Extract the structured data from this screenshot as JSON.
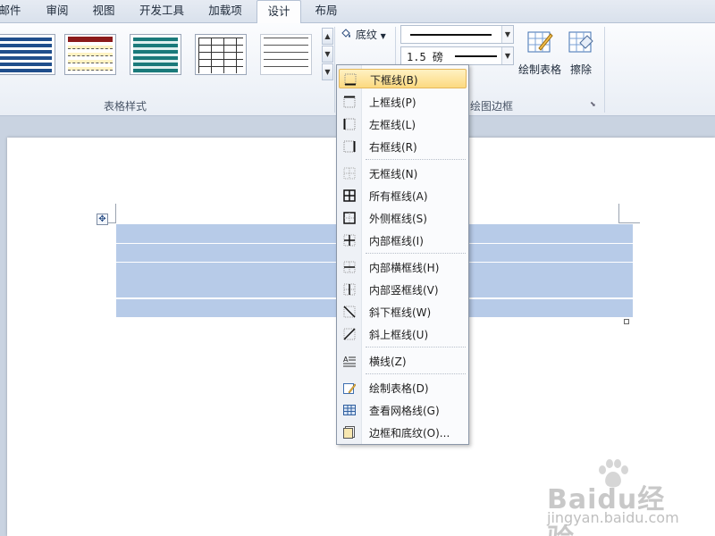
{
  "tabs": [
    {
      "label": "邮件",
      "active": false
    },
    {
      "label": "审阅",
      "active": false
    },
    {
      "label": "视图",
      "active": false
    },
    {
      "label": "开发工具",
      "active": false
    },
    {
      "label": "加载项",
      "active": false
    },
    {
      "label": "设计",
      "active": true
    },
    {
      "label": "布局",
      "active": false
    }
  ],
  "ribbon": {
    "table_styles_label": "表格样式",
    "shading_label": "底纹",
    "borders_label": "边框",
    "line_weight": "1.5 磅",
    "draw_table_label": "绘制表格",
    "eraser_label": "擦除",
    "draw_borders_label": "绘图边框",
    "swatch_colors": [
      "#1f4e8c",
      "#8b1a1a",
      "#1a7a7a",
      "#333333",
      "#333333"
    ]
  },
  "menu": {
    "items": [
      {
        "label": "下框线(B)",
        "icon": "bottom-border-icon",
        "highlighted": true
      },
      {
        "label": "上框线(P)",
        "icon": "top-border-icon"
      },
      {
        "label": "左框线(L)",
        "icon": "left-border-icon"
      },
      {
        "label": "右框线(R)",
        "icon": "right-border-icon"
      },
      {
        "label": "无框线(N)",
        "icon": "no-border-icon"
      },
      {
        "label": "所有框线(A)",
        "icon": "all-borders-icon"
      },
      {
        "label": "外侧框线(S)",
        "icon": "outside-borders-icon"
      },
      {
        "label": "内部框线(I)",
        "icon": "inside-borders-icon"
      },
      {
        "label": "内部横框线(H)",
        "icon": "inside-horizontal-border-icon"
      },
      {
        "label": "内部竖框线(V)",
        "icon": "inside-vertical-border-icon"
      },
      {
        "label": "斜下框线(W)",
        "icon": "diagonal-down-border-icon"
      },
      {
        "label": "斜上框线(U)",
        "icon": "diagonal-up-border-icon"
      },
      {
        "label": "横线(Z)",
        "icon": "horizontal-line-icon"
      },
      {
        "label": "绘制表格(D)",
        "icon": "draw-table-icon"
      },
      {
        "label": "查看网格线(G)",
        "icon": "view-gridlines-icon"
      },
      {
        "label": "边框和底纹(O)...",
        "icon": "borders-and-shading-icon"
      }
    ]
  },
  "watermark": {
    "text": "Baidu经验",
    "sub": "jingyan.baidu.com"
  }
}
